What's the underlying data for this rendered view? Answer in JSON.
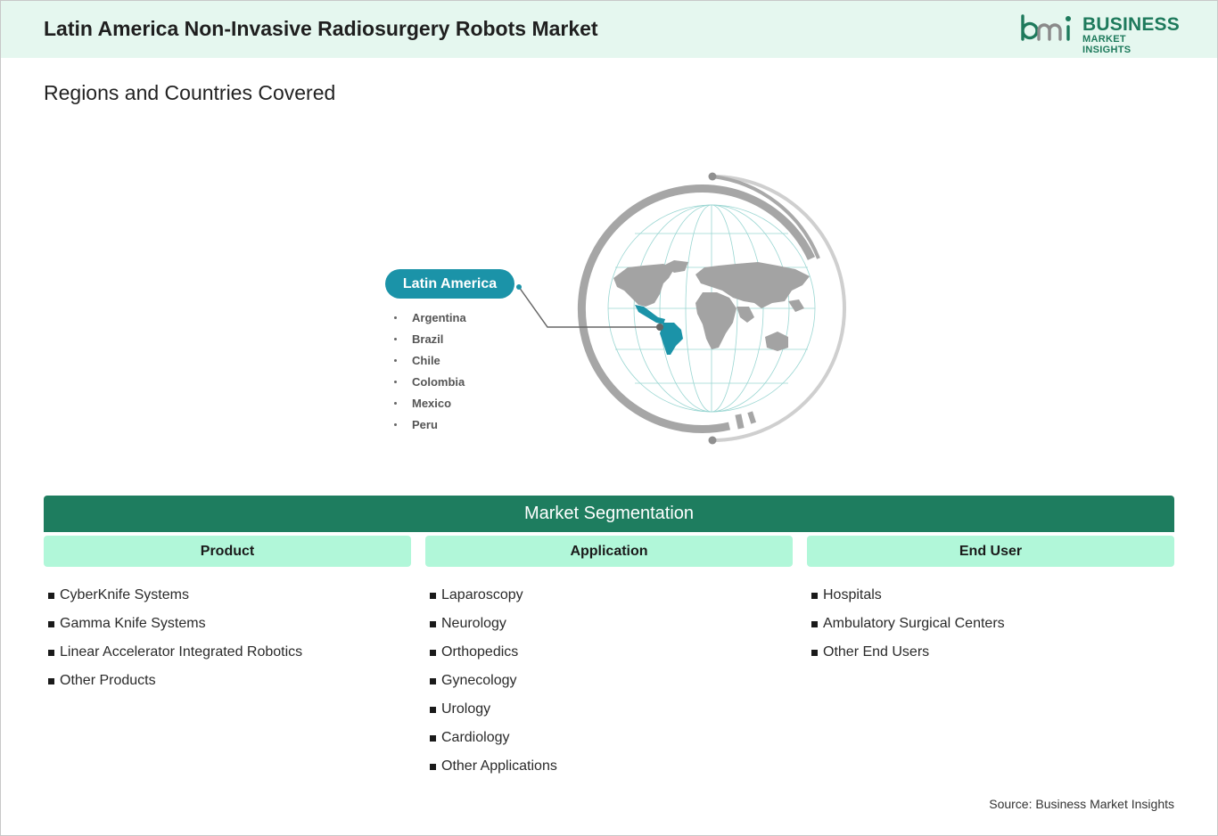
{
  "header": {
    "title": "Latin America Non-Invasive Radiosurgery Robots Market",
    "logo": {
      "line1": "BUSINESS",
      "line2": "MARKET INSIGHTS",
      "color": "#1e7a5c"
    }
  },
  "regions": {
    "section_title": "Regions and Countries Covered",
    "region_label": "Latin America",
    "countries": [
      "Argentina",
      "Brazil",
      "Chile",
      "Colombia",
      "Mexico",
      "Peru"
    ],
    "highlight_color": "#1b93a8"
  },
  "segmentation": {
    "title": "Market Segmentation",
    "columns": [
      {
        "heading": "Product",
        "items": [
          "CyberKnife Systems",
          "Gamma Knife Systems",
          "Linear Accelerator Integrated Robotics",
          "Other Products"
        ]
      },
      {
        "heading": "Application",
        "items": [
          "Laparoscopy",
          "Neurology",
          "Orthopedics",
          "Gynecology",
          "Urology",
          "Cardiology",
          "Other Applications"
        ]
      },
      {
        "heading": "End User",
        "items": [
          "Hospitals",
          "Ambulatory Surgical Centers",
          "Other End Users"
        ]
      }
    ]
  },
  "footer": {
    "source": "Source: Business Market Insights"
  }
}
